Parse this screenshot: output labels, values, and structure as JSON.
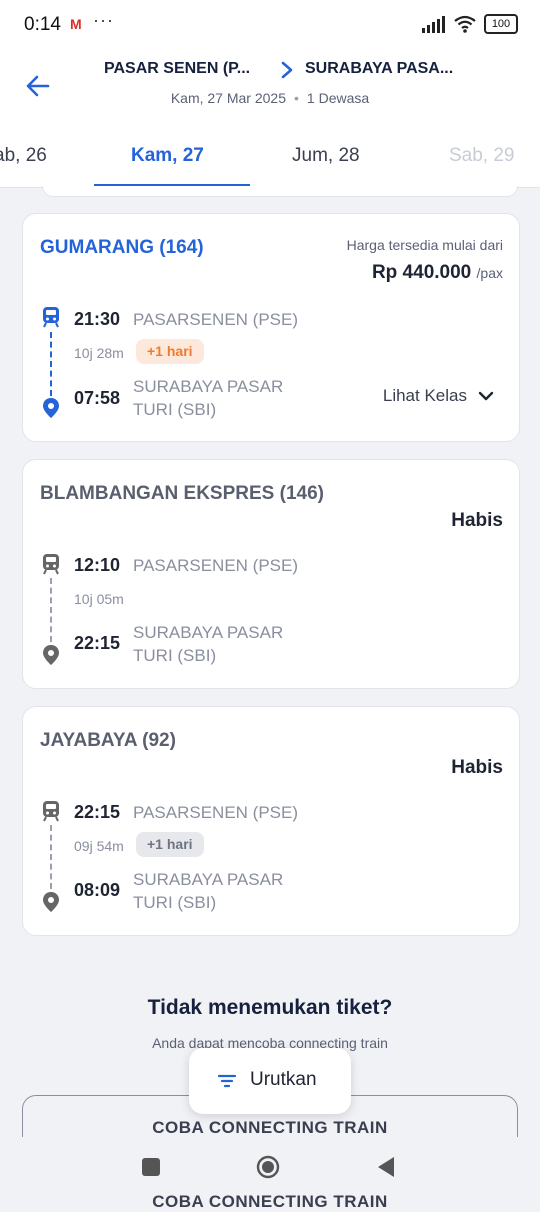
{
  "status_bar": {
    "time": "0:14",
    "gmail": "M",
    "dots": "···",
    "battery": "100"
  },
  "header": {
    "from": "PASAR SENEN (P...",
    "to": "SURABAYA PASA...",
    "date": "Kam, 27 Mar 2025",
    "passengers": "1 Dewasa"
  },
  "date_tabs": [
    {
      "label": "ab, 26"
    },
    {
      "label": "Kam, 27"
    },
    {
      "label": "Jum, 28"
    },
    {
      "label": "Sab, 29"
    }
  ],
  "trains": [
    {
      "name": "GUMARANG (164)",
      "price_note": "Harga tersedia mulai dari",
      "price": "Rp 440.000",
      "price_unit": "/pax",
      "depart_time": "21:30",
      "depart_station": "PASARSENEN (PSE)",
      "duration": "10j 28m",
      "badge": "+1 hari",
      "arrive_time": "07:58",
      "arrive_station_line1": "SURABAYA PASAR",
      "arrive_station_line2": "TURI (SBI)",
      "lihat_kelas": "Lihat Kelas"
    },
    {
      "name": "BLAMBANGAN EKSPRES (146)",
      "status": "Habis",
      "depart_time": "12:10",
      "depart_station": "PASARSENEN (PSE)",
      "duration": "10j 05m",
      "arrive_time": "22:15",
      "arrive_station_line1": "SURABAYA PASAR",
      "arrive_station_line2": "TURI (SBI)"
    },
    {
      "name": "JAYABAYA (92)",
      "status": "Habis",
      "depart_time": "22:15",
      "depart_station": "PASARSENEN (PSE)",
      "duration": "09j 54m",
      "badge": "+1 hari",
      "arrive_time": "08:09",
      "arrive_station_line1": "SURABAYA PASAR",
      "arrive_station_line2": "TURI (SBI)"
    }
  ],
  "not_found": {
    "title": "Tidak menemukan tiket?",
    "subtitle": "Anda dapat mencoba connecting train",
    "connect_button": "COBA CONNECTING TRAIN"
  },
  "sort_button": "Urutkan",
  "colors": {
    "accent": "#2563d9",
    "badge_orange": "#ef7b2f",
    "text_dark": "#1f2433"
  },
  "icons": [
    "back-arrow-icon",
    "chevron-right-icon",
    "train-icon",
    "location-pin-icon",
    "chevron-down-icon",
    "filter-icon",
    "wifi-icon",
    "signal-icon",
    "battery-icon"
  ]
}
